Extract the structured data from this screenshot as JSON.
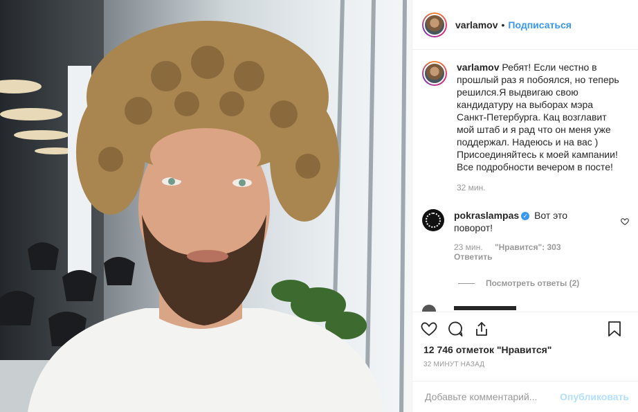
{
  "header": {
    "username": "varlamov",
    "separator": "•",
    "follow_label": "Подписаться"
  },
  "caption": {
    "username": "varlamov",
    "text": "Ребят! Если честно в прошлый раз я побоялся, но теперь решился.Я выдвигаю свою кандидатуру на выборах мэра Санкт-Петербурга. Кац возглавит мой штаб и я рад что он меня уже поддержал. Надеюсь и на вас ) Присоединяйтесь к моей кампании! Все подробности вечером в посте!",
    "time": "32 мин."
  },
  "comments": [
    {
      "username": "pokraslampas",
      "verified": true,
      "text": "Вот это поворот!",
      "time": "23 мин.",
      "likes_text": "\"Нравится\": 303",
      "reply_label": "Ответить"
    }
  ],
  "view_replies": "Посмотреть ответы (2)",
  "likes": "12 746 отметок \"Нравится\"",
  "posted_time": "32 МИНУТ НАЗАД",
  "comment_input": {
    "placeholder": "Добавьте комментарий..."
  },
  "publish_label": "Опубликовать",
  "icons": [
    "heart-icon",
    "comment-icon",
    "share-icon",
    "bookmark-icon",
    "small-heart-icon"
  ],
  "colors": {
    "accent": "#3897f0",
    "publish_disabled": "#b2dffc",
    "muted": "#999999",
    "text": "#262626"
  }
}
